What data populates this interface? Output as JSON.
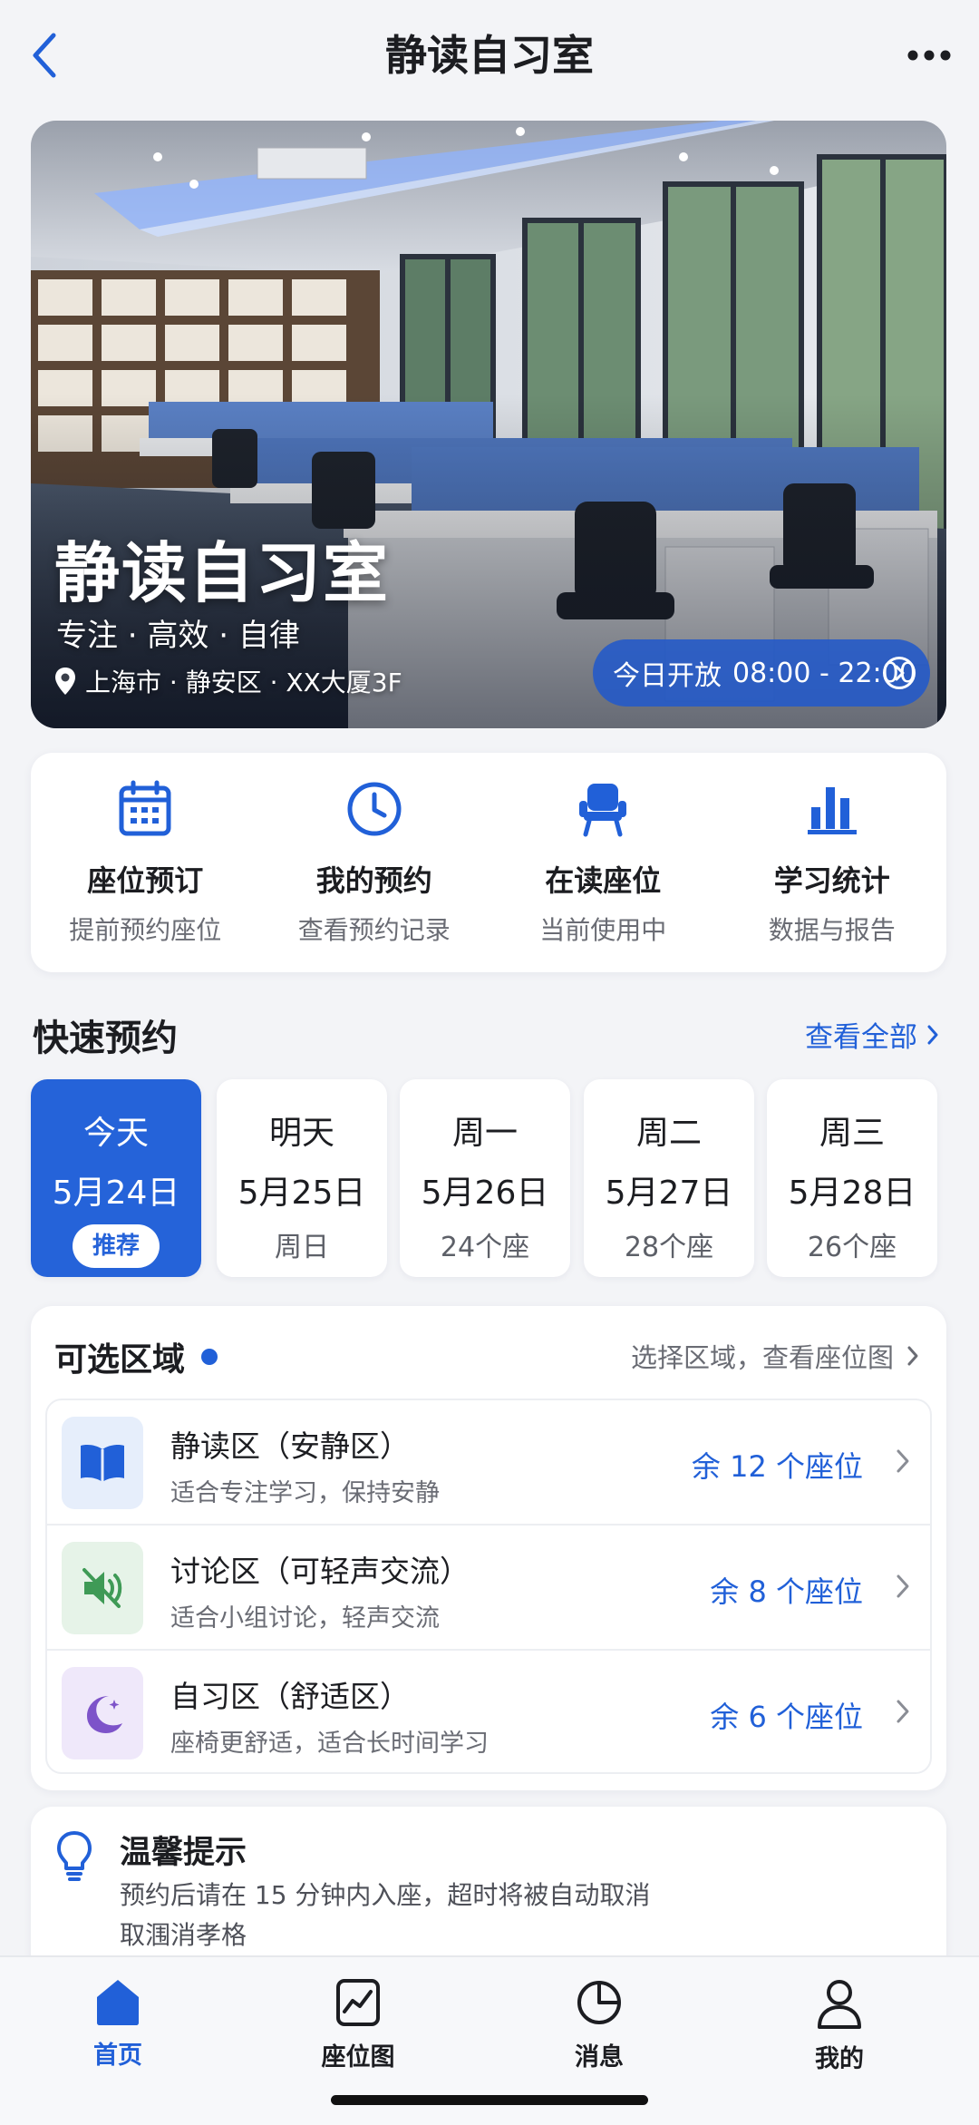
{
  "header": {
    "title": "静读自习室"
  },
  "hero": {
    "title": "静读自习室",
    "slogan": "专注 · 高效 · 自律",
    "location": "上海市 · 静安区 · XX大厦3F",
    "open_label": "今日开放",
    "open_hours": "08:00 - 22:00"
  },
  "actions": [
    {
      "title": "座位预订",
      "sub": "提前预约座位",
      "icon": "calendar-icon"
    },
    {
      "title": "我的预约",
      "sub": "查看预约记录",
      "icon": "clock-icon"
    },
    {
      "title": "在读座位",
      "sub": "当前使用中",
      "icon": "chair-icon"
    },
    {
      "title": "学习统计",
      "sub": "数据与报告",
      "icon": "bar-chart-icon"
    }
  ],
  "quick_booking": {
    "title": "快速预约",
    "see_all": "查看全部",
    "days": [
      {
        "day": "今天",
        "date": "5月24日",
        "extra": "推荐",
        "selected": true
      },
      {
        "day": "明天",
        "date": "5月25日",
        "extra": "周日"
      },
      {
        "day": "周一",
        "date": "5月26日",
        "extra": "24个座"
      },
      {
        "day": "周二",
        "date": "5月27日",
        "extra": "28个座"
      },
      {
        "day": "周三",
        "date": "5月28日",
        "extra": "26个座"
      }
    ]
  },
  "zones": {
    "title": "可选区域",
    "hint": "选择区域，查看座位图",
    "items": [
      {
        "name": "静读区（安静区）",
        "desc": "适合专注学习，保持安静",
        "seats": "余 12 个座位",
        "icon": "book-icon"
      },
      {
        "name": "讨论区（可轻声交流）",
        "desc": "适合小组讨论，轻声交流",
        "seats": "余 8 个座位",
        "icon": "speaker-muted-icon"
      },
      {
        "name": "自习区（舒适区）",
        "desc": "座椅更舒适，适合长时间学习",
        "seats": "余 6 个座位",
        "icon": "moon-icon"
      }
    ]
  },
  "tip": {
    "title": "温馨提示",
    "line1": "预约后请在 15 分钟内入座，超时将被自动取消",
    "line2": "取涠消孝格"
  },
  "tabbar": [
    {
      "label": "首页",
      "icon": "home-icon",
      "active": true
    },
    {
      "label": "座位图",
      "icon": "seat-map-icon"
    },
    {
      "label": "消息",
      "icon": "message-icon"
    },
    {
      "label": "我的",
      "icon": "profile-icon"
    }
  ],
  "colors": {
    "accent": "#2160d8",
    "accent_fill": "#2563d9",
    "background": "#f3f4f7"
  }
}
